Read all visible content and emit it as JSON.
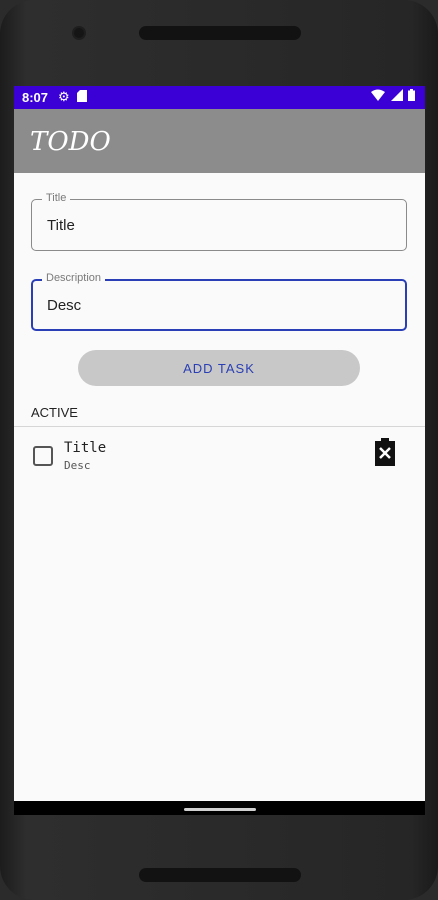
{
  "status_bar": {
    "time": "8:07",
    "left_icons": [
      "gear-icon",
      "sd-card-icon"
    ],
    "right_icons": [
      "wifi-icon",
      "signal-icon",
      "battery-icon"
    ],
    "color": "#3a00d6"
  },
  "app_bar": {
    "title": "TODO",
    "color": "#8c8c8c"
  },
  "form": {
    "title_field": {
      "label": "Title",
      "value": "Title"
    },
    "description_field": {
      "label": "Description",
      "value": "Desc",
      "focused": true
    },
    "add_button_label": "ADD TASK",
    "accent_color": "#2a3fb5"
  },
  "active_section": {
    "header": "ACTIVE",
    "tasks": [
      {
        "title": "Title",
        "description": "Desc",
        "checked": false
      }
    ]
  }
}
